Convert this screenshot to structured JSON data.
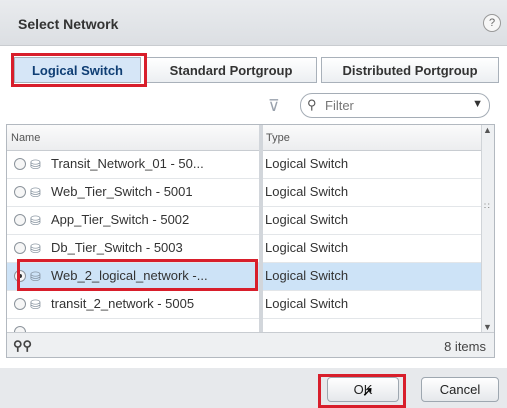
{
  "dialog": {
    "title": "Select Network",
    "help_label": "?"
  },
  "tabs": [
    {
      "label": "Logical Switch",
      "active": true
    },
    {
      "label": "Standard Portgroup",
      "active": false
    },
    {
      "label": "Distributed Portgroup",
      "active": false
    }
  ],
  "filter": {
    "placeholder": "Filter",
    "funnel_icon": "funnel-icon",
    "search_icon": "search-icon"
  },
  "grid": {
    "columns": [
      "Name",
      "Type"
    ],
    "rows": [
      {
        "name": "Transit_Network_01 - 50...",
        "type": "Logical Switch",
        "selected": false
      },
      {
        "name": "Web_Tier_Switch - 5001",
        "type": "Logical Switch",
        "selected": false
      },
      {
        "name": "App_Tier_Switch - 5002",
        "type": "Logical Switch",
        "selected": false
      },
      {
        "name": "Db_Tier_Switch - 5003",
        "type": "Logical Switch",
        "selected": false
      },
      {
        "name": "Web_2_logical_network -...",
        "type": "Logical Switch",
        "selected": true
      },
      {
        "name": "transit_2_network - 5005",
        "type": "Logical Switch",
        "selected": false
      }
    ],
    "item_count": "8 items"
  },
  "buttons": {
    "ok": "OK",
    "cancel": "Cancel"
  },
  "colors": {
    "highlight": "#d81e2b",
    "selected_row": "#cde3f7",
    "active_tab": "#d6e6f7"
  }
}
